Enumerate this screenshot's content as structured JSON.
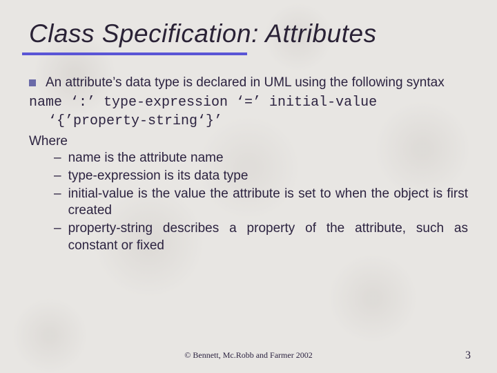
{
  "title": "Class Specification: Attributes",
  "intro": "An attribute’s data type is declared in UML using the following syntax",
  "syntax_line1": "name ‘:’ type-expression ‘=’ initial-value",
  "syntax_line2": "‘{’property-string‘}’",
  "where_heading": "Where",
  "where_items": [
    "name is the attribute name",
    "type-expression is its data type",
    "initial-value is the value the attribute is set to when the object is first created",
    "property-string describes a property of the attribute, such as constant or fixed"
  ],
  "footer": "©  Bennett, Mc.Robb and Farmer 2002",
  "page_number": "3"
}
